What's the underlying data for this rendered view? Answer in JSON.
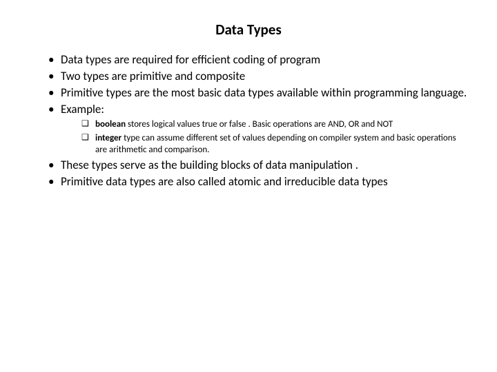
{
  "title": "Data Types",
  "bullets1": [
    "Data types are required for efficient coding of program",
    "Two types are primitive and composite",
    "Primitive types are the most basic data types available within programming language.",
    "Example:"
  ],
  "nested": [
    {
      "bold": "boolean",
      "rest": " stores logical values true or false . Basic operations are AND, OR and NOT"
    },
    {
      "bold": "integer",
      "rest": " type can assume different set of values depending on compiler system and basic operations are arithmetic and comparison."
    }
  ],
  "bullets2": [
    "These types serve as the building blocks of data manipulation .",
    "Primitive data types are  also called atomic and irreducible data types"
  ]
}
